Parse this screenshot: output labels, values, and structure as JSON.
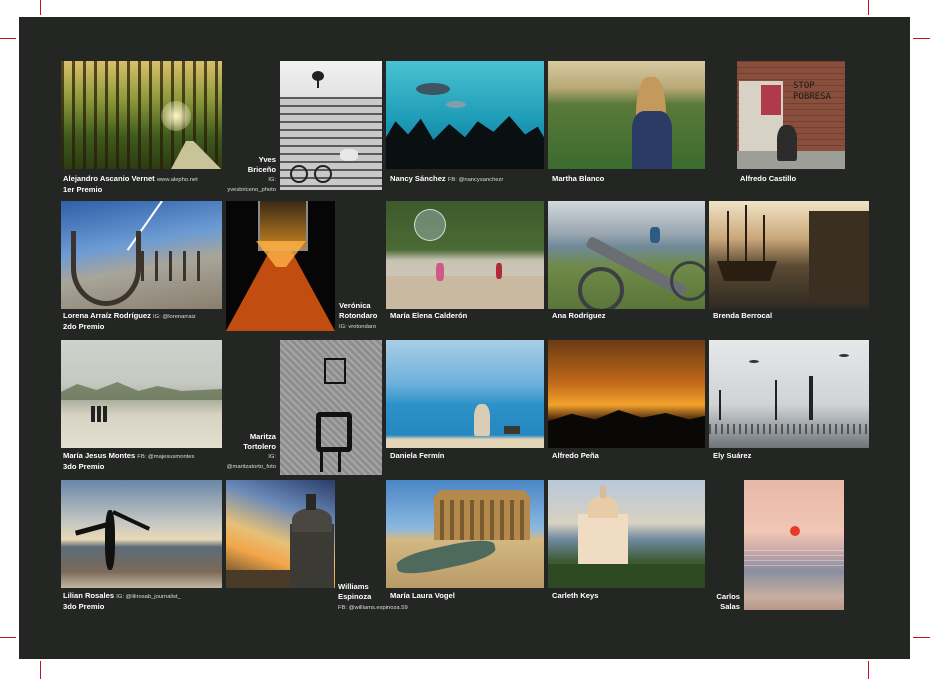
{
  "entries": [
    {
      "name": "Alejandro Ascanio Vernet",
      "handle": "www.alepho.net",
      "prize": "1er Premio"
    },
    {
      "name": "Yves Briceño",
      "name_l1": "Yves",
      "name_l2": "Briceño",
      "handle_l1": "IG:",
      "handle_l2": "yvesbriceno_photo"
    },
    {
      "name": "Nancy Sánchez",
      "handle": "FB: @nancysanchezr"
    },
    {
      "name": "Martha Blanco"
    },
    {
      "name": "Alfredo Castillo"
    },
    {
      "name": "Lorena Arraíz Rodríguez",
      "handle": "IG: @lorenarraiz",
      "prize": "2do Premio"
    },
    {
      "name": "Verónica Rotondaro",
      "name_l1": "Verónica",
      "name_l2": "Rotondaro",
      "handle": "IG: vrotondaro"
    },
    {
      "name": "María Elena Calderón"
    },
    {
      "name": "Ana Rodríguez"
    },
    {
      "name": "Brenda Berrocal"
    },
    {
      "name": "María Jesus Montes",
      "handle": "FB: @majesusmontes",
      "prize": "3do Premio"
    },
    {
      "name": "Maritza Tortolero",
      "name_l1": "Maritza",
      "name_l2": "Tortolero",
      "handle_l1": "IG:",
      "handle_l2": "@maritzatorto_foto"
    },
    {
      "name": "Daniela Fermín"
    },
    {
      "name": "Alfredo Peña"
    },
    {
      "name": "Ely Suárez"
    },
    {
      "name": "Lilian Rosales",
      "handle": "IG: @lilirosab_journalist_",
      "prize": "3do Premio"
    },
    {
      "name": "Williams Espinoza",
      "name_l1": "Williams",
      "name_l2": "Espinoza",
      "handle": "FB: @williams.espinoza.59"
    },
    {
      "name": "María Laura Vogel"
    },
    {
      "name": "Carleth Keys"
    },
    {
      "name": "Carlos Salas",
      "name_l1": "Carlos",
      "name_l2": "Salas"
    }
  ],
  "sign_text_l1": "STOP",
  "sign_text_l2": "POBRESA",
  "colors": {
    "board": "#242624",
    "crop_marks": "#c8102e",
    "caption": "#ffffff"
  }
}
